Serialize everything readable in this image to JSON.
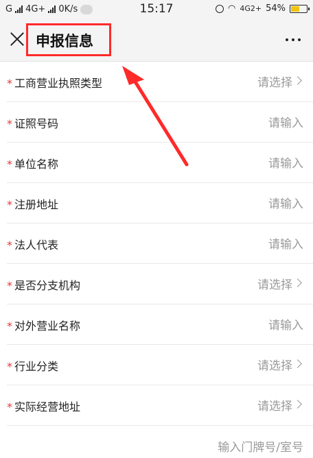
{
  "statusbar": {
    "carrier": "G",
    "network": "4G+",
    "speed": "0K/s",
    "time": "15:17",
    "network2": "4G2+",
    "battery": "54%"
  },
  "header": {
    "title": "申报信息"
  },
  "form": {
    "required_mark": "*",
    "select_placeholder": "请选择",
    "input_placeholder": "请输入",
    "fields": [
      {
        "label": "工商营业执照类型",
        "value": "请选择",
        "type": "select"
      },
      {
        "label": "证照号码",
        "value": "请输入",
        "type": "input"
      },
      {
        "label": "单位名称",
        "value": "请输入",
        "type": "input"
      },
      {
        "label": "注册地址",
        "value": "请输入",
        "type": "input"
      },
      {
        "label": "法人代表",
        "value": "请输入",
        "type": "input"
      },
      {
        "label": "是否分支机构",
        "value": "请选择",
        "type": "select"
      },
      {
        "label": "对外营业名称",
        "value": "请输入",
        "type": "input"
      },
      {
        "label": "行业分类",
        "value": "请选择",
        "type": "select"
      },
      {
        "label": "实际经营地址",
        "value": "请选择",
        "type": "select"
      }
    ],
    "bottom_input": "输入门牌号/室号"
  },
  "colors": {
    "annotation_red": "#ff2a2a",
    "required_red": "#e53935",
    "placeholder_gray": "#9a9a9a"
  }
}
